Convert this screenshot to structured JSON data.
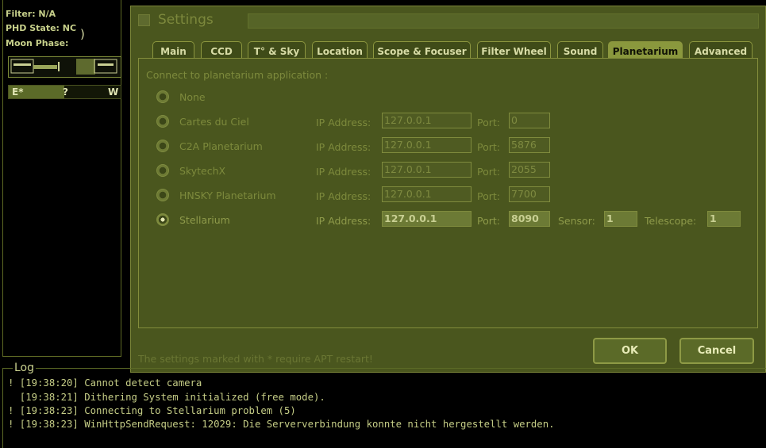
{
  "status": {
    "filter": "Filter: N/A",
    "phd": "PHD State: NC",
    "moon": "Moon Phase:",
    "moon_glyph": ")"
  },
  "compass": {
    "left": "E*",
    "mid": "?",
    "right": "W",
    "fill_fraction": 0.5
  },
  "dialog": {
    "title": "Settings",
    "tabs": [
      {
        "label": "Main"
      },
      {
        "label": "CCD"
      },
      {
        "label": "T° & Sky"
      },
      {
        "label": "Location"
      },
      {
        "label": "Scope & Focuser"
      },
      {
        "label": "Filter Wheel"
      },
      {
        "label": "Sound"
      },
      {
        "label": "Planetarium"
      },
      {
        "label": "Advanced"
      }
    ],
    "active_tab": "Planetarium",
    "connect_label": "Connect to planetarium application :",
    "ip_label": "IP Address:",
    "port_label": "Port:",
    "sensor_label": "Sensor:",
    "telescope_label": "Telescope:",
    "options": [
      {
        "name": "None"
      },
      {
        "name": "Cartes du Ciel",
        "ip": "127.0.0.1",
        "port": "0"
      },
      {
        "name": "C2A Planetarium",
        "ip": "127.0.0.1",
        "port": "5876"
      },
      {
        "name": "SkytechX",
        "ip": "127.0.0.1",
        "port": "2055"
      },
      {
        "name": "HNSKY Planetarium",
        "ip": "127.0.0.1",
        "port": "7700"
      },
      {
        "name": "Stellarium",
        "ip": "127.0.0.1",
        "port": "8090",
        "sensor": "1",
        "telescope": "1"
      }
    ],
    "selected_option": "Stellarium",
    "note": "The settings marked with * require APT restart!",
    "ok_label": "OK",
    "cancel_label": "Cancel"
  },
  "log": {
    "title": "Log",
    "lines": [
      "! [19:38:20] Cannot detect camera",
      "  [19:38:21] Dithering System initialized (free mode).",
      "! [19:38:23] Connecting to Stellarium problem (5)",
      "! [19:38:23] WinHttpSendRequest: 12029: Die Serververbindung konnte nicht hergestellt werden."
    ]
  }
}
